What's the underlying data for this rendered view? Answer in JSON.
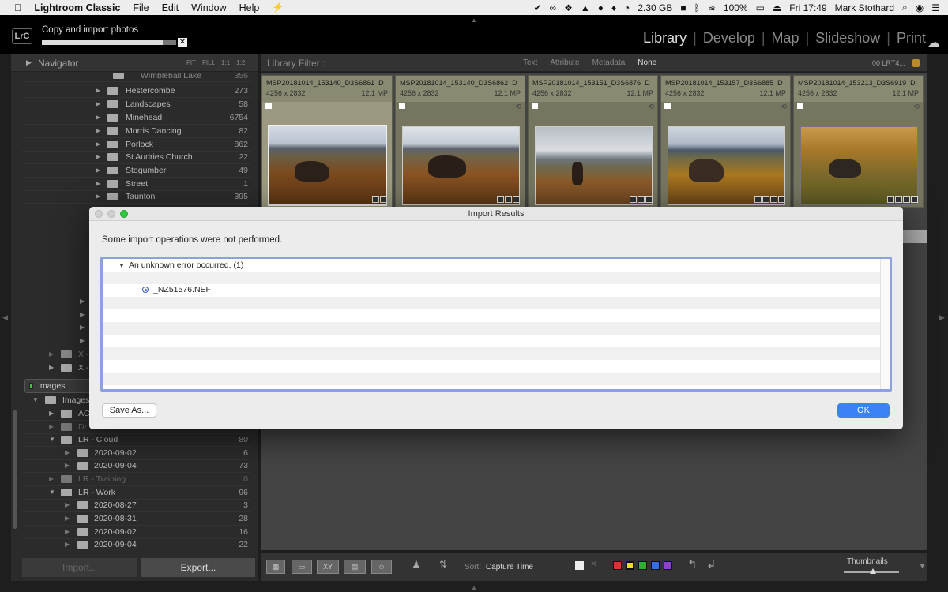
{
  "menubar": {
    "apple": "",
    "app": "Lightroom Classic",
    "items": [
      "File",
      "Edit",
      "Window",
      "Help"
    ],
    "memory": "2.30 GB",
    "battery": "100%",
    "clock": "Fri 17:49",
    "user": "Mark Stothard"
  },
  "topbar": {
    "logo": "LrC",
    "import_status": "Copy and import photos",
    "import_progress": 0.9,
    "modules": [
      "Library",
      "Develop",
      "Map",
      "Slideshow",
      "Print"
    ],
    "active_module": "Library"
  },
  "navigator": {
    "title": "Navigator",
    "options": [
      "FIT",
      "FILL",
      "1:1",
      "1:2"
    ]
  },
  "folders": [
    {
      "name": "Wimbleball Lake",
      "count": "356"
    },
    {
      "name": "Hestercombe",
      "count": "273"
    },
    {
      "name": "Landscapes",
      "count": "58"
    },
    {
      "name": "Minehead",
      "count": "6754"
    },
    {
      "name": "Morris Dancing",
      "count": "82"
    },
    {
      "name": "Porlock",
      "count": "862"
    },
    {
      "name": "St Audries Church",
      "count": "22"
    },
    {
      "name": "Stogumber",
      "count": "49"
    },
    {
      "name": "Street",
      "count": "1"
    },
    {
      "name": "Taunton",
      "count": "395"
    }
  ],
  "volumes": [
    {
      "name": "X -"
    },
    {
      "name": "X -"
    }
  ],
  "images_panel": {
    "label": "Images"
  },
  "image_folders": [
    {
      "name": "Images",
      "count": ""
    },
    {
      "name": "AC",
      "count": ""
    },
    {
      "name": "Dr",
      "count": ""
    },
    {
      "name": "LR - Cloud",
      "count": "80"
    },
    {
      "name": "2020-09-02",
      "count": "6"
    },
    {
      "name": "2020-09-04",
      "count": "73"
    },
    {
      "name": "LR - Training",
      "count": "0"
    },
    {
      "name": "LR - Work",
      "count": "96"
    },
    {
      "name": "2020-08-27",
      "count": "3"
    },
    {
      "name": "2020-08-31",
      "count": "28"
    },
    {
      "name": "2020-09-02",
      "count": "16"
    },
    {
      "name": "2020-09-04",
      "count": "22"
    }
  ],
  "buttons": {
    "import": "Import...",
    "export": "Export..."
  },
  "filter": {
    "title": "Library Filter :",
    "options": [
      "Text",
      "Attribute",
      "Metadata",
      "None"
    ],
    "selected": "None",
    "preset": "00 LRT4..."
  },
  "grid": [
    {
      "name": "MSP20181014_153140_D3S6861",
      "ext": "D",
      "dims": "4256 x 2832",
      "mp": "12.1 MP"
    },
    {
      "name": "MSP20181014_153140_D3S6862",
      "ext": "D",
      "dims": "4256 x 2832",
      "mp": "12.1 MP"
    },
    {
      "name": "MSP20181014_153151_D3S6876",
      "ext": "D",
      "dims": "4256 x 2832",
      "mp": "12.1 MP"
    },
    {
      "name": "MSP20181014_153157_D3S6885",
      "ext": "D",
      "dims": "4256 x 2832",
      "mp": "12.1 MP"
    },
    {
      "name": "MSP20181014_153213_D3S6919",
      "ext": "D",
      "dims": "4256 x 2832",
      "mp": "12.1 MP"
    }
  ],
  "toolbar": {
    "sort_label": "Sort:",
    "sort_value": "Capture Time",
    "thumbnails_label": "Thumbnails",
    "swatches": [
      "#e03030",
      "#e8e020",
      "#30b030",
      "#3070e0",
      "#9040d0"
    ]
  },
  "dialog": {
    "title": "Import Results",
    "message": "Some import operations were not performed.",
    "error": "An unknown error occurred. (1)",
    "file": "_NZ51576.NEF",
    "save_as": "Save As...",
    "ok": "OK"
  }
}
